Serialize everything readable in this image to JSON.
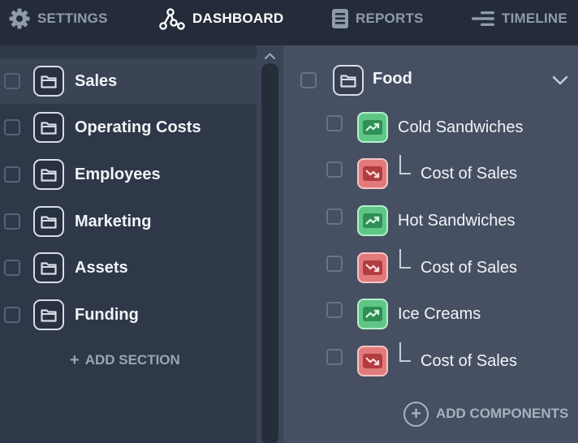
{
  "nav": {
    "settings": {
      "label": "SETTINGS",
      "icon": "gear-icon"
    },
    "dashboard": {
      "label": "DASHBOARD",
      "icon": "nodes-icon"
    },
    "reports": {
      "label": "REPORTS",
      "icon": "document-icon"
    },
    "timeline": {
      "label": "TIMELINE",
      "icon": "timeline-icon"
    }
  },
  "sections": [
    {
      "label": "Sales",
      "selected": true
    },
    {
      "label": "Operating Costs"
    },
    {
      "label": "Employees"
    },
    {
      "label": "Marketing"
    },
    {
      "label": "Assets"
    },
    {
      "label": "Funding"
    }
  ],
  "add_section": "ADD SECTION",
  "group": {
    "title": "Food",
    "components": [
      {
        "label": "Cold Sandwiches",
        "kind": "revenue",
        "icon": "trend-up-icon"
      },
      {
        "label": "Cost of Sales",
        "kind": "cost",
        "icon": "trend-down-icon"
      },
      {
        "label": "Hot Sandwiches",
        "kind": "revenue",
        "icon": "trend-up-icon"
      },
      {
        "label": "Cost of Sales",
        "kind": "cost",
        "icon": "trend-down-icon"
      },
      {
        "label": "Ice Creams",
        "kind": "revenue",
        "icon": "trend-up-icon"
      },
      {
        "label": "Cost of Sales",
        "kind": "cost",
        "icon": "trend-down-icon"
      }
    ]
  },
  "add_components": "ADD COMPONENTS",
  "colors": {
    "revenue": "#5fc685",
    "cost": "#e27a7c",
    "nav_bg": "#242c39",
    "left_bg": "#2f3848",
    "right_bg": "#465062"
  }
}
